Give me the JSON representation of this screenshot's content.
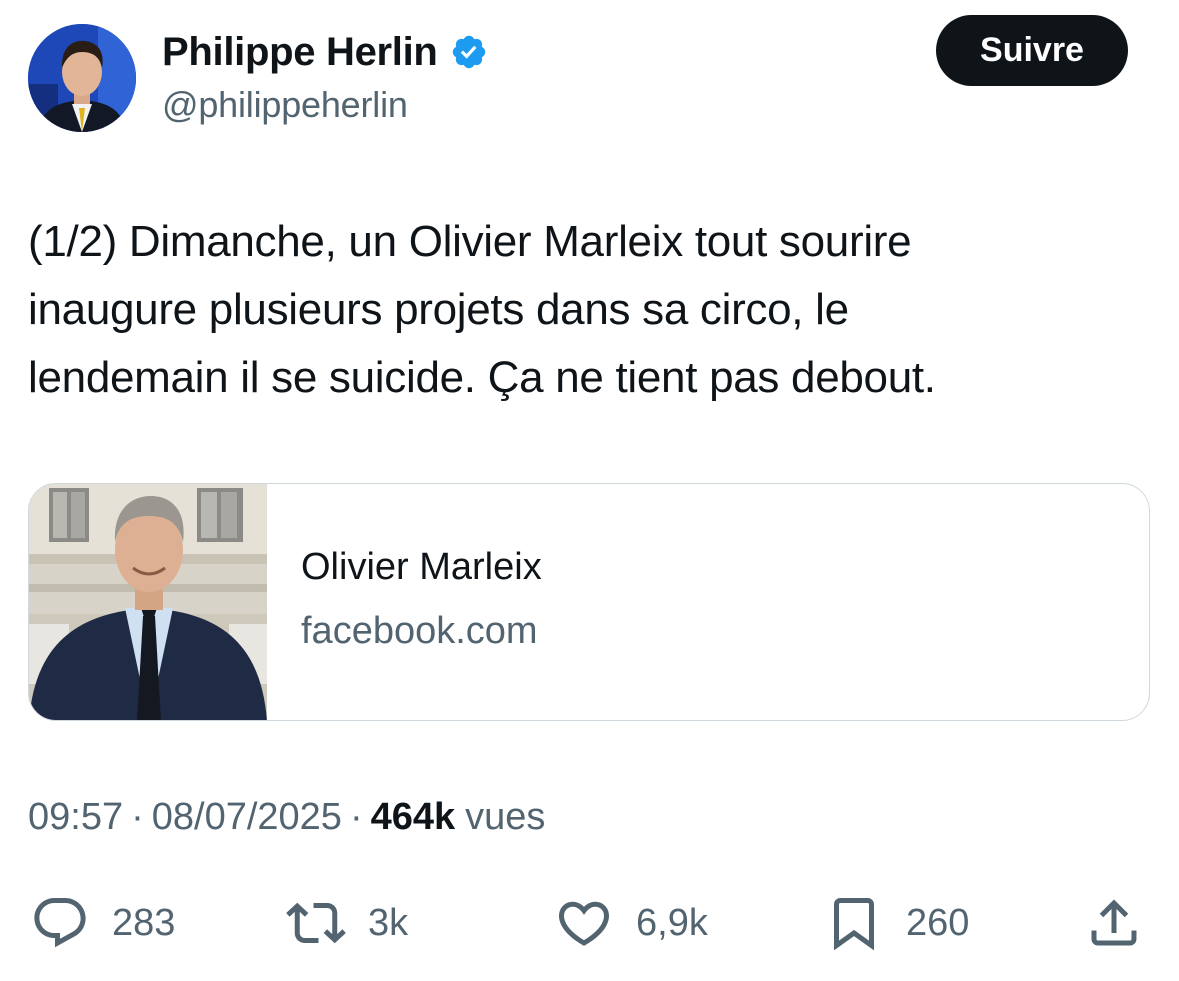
{
  "author": {
    "display_name": "Philippe Herlin",
    "handle": "@philippeherlin",
    "verified": true,
    "verified_color": "#1d9bf0"
  },
  "follow_button": {
    "label": "Suivre"
  },
  "tweet": {
    "text_lines": [
      "(1/2) Dimanche, un Olivier Marleix tout sourire",
      "inaugure plusieurs projets dans sa circo, le",
      "lendemain il se suicide. Ça ne tient pas debout."
    ]
  },
  "link_card": {
    "title": "Olivier Marleix",
    "domain": "facebook.com"
  },
  "meta": {
    "time": "09:57",
    "separator": "·",
    "date": "08/07/2025",
    "views_count": "464k",
    "views_label": "vues"
  },
  "actions": {
    "replies": "283",
    "reposts": "3k",
    "likes": "6,9k",
    "bookmarks": "260"
  },
  "icons": {
    "reply": "reply-bubble-icon",
    "repost": "repost-arrows-icon",
    "like": "heart-icon",
    "bookmark": "bookmark-icon",
    "share": "share-upload-icon",
    "verified": "verified-badge-icon"
  },
  "colors": {
    "text_primary": "#0f1419",
    "text_secondary": "#536471",
    "card_border": "#cfd9de",
    "follow_bg": "#0f1419"
  }
}
